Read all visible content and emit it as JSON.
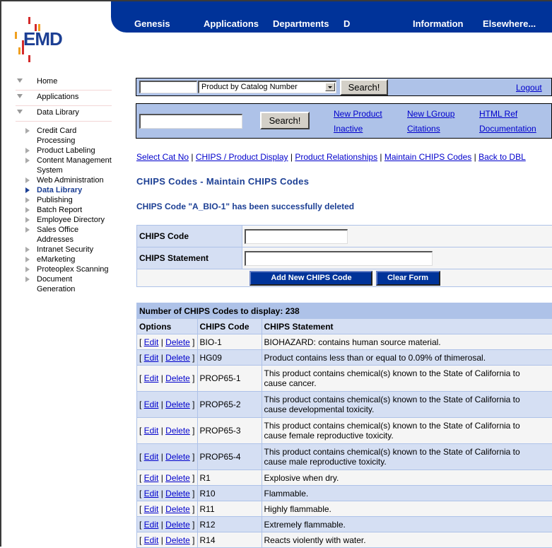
{
  "logo": {
    "text": "EMD",
    "colors": {
      "text": "#1c3f94",
      "red": "#d42a2a",
      "orange": "#f0a020"
    }
  },
  "topnav": {
    "items": [
      "Genesis",
      "Applications",
      "Departments",
      "D",
      "Information",
      "Elsewhere..."
    ],
    "background": "#003399"
  },
  "sidebar": {
    "top_items": [
      {
        "label": "Home",
        "icon": "triangle-down-icon"
      },
      {
        "label": "Applications",
        "icon": "triangle-down-icon"
      },
      {
        "label": "Data Library",
        "icon": "triangle-down-icon"
      }
    ],
    "sub_items": [
      {
        "label": "Credit Card Processing",
        "lines": [
          "Credit Card",
          "Processing"
        ],
        "active": false
      },
      {
        "label": "Product Labeling",
        "lines": [
          "Product Labeling"
        ],
        "active": false
      },
      {
        "label": "Content Management System",
        "lines": [
          "Content Management",
          "System"
        ],
        "active": false
      },
      {
        "label": "Web Administration",
        "lines": [
          "Web Administration"
        ],
        "active": false
      },
      {
        "label": "Data Library",
        "lines": [
          "Data Library"
        ],
        "active": true
      },
      {
        "label": "Publishing",
        "lines": [
          "Publishing"
        ],
        "active": false
      },
      {
        "label": "Batch Report",
        "lines": [
          "Batch Report"
        ],
        "active": false
      },
      {
        "label": "Employee Directory",
        "lines": [
          "Employee Directory"
        ],
        "active": false
      },
      {
        "label": "Sales Office Addresses",
        "lines": [
          "Sales Office",
          "Addresses"
        ],
        "active": false
      },
      {
        "label": "Intranet Security",
        "lines": [
          "Intranet Security"
        ],
        "active": false
      },
      {
        "label": "eMarketing",
        "lines": [
          "eMarketing"
        ],
        "active": false
      },
      {
        "label": "Proteoplex Scanning",
        "lines": [
          "Proteoplex Scanning"
        ],
        "active": false
      },
      {
        "label": "Document Generation",
        "lines": [
          "Document Generation"
        ],
        "active": false
      }
    ]
  },
  "search_bar": {
    "input_value": "",
    "select_value": "Product by Catalog Number",
    "search_label": "Search!",
    "logout_label": "Logout"
  },
  "quick_bar": {
    "input_value": "",
    "search_label": "Search!",
    "links": {
      "new_product": "New Product",
      "inactive": "Inactive",
      "new_lgroup": "New LGroup",
      "citations": "Citations",
      "html_ref": "HTML Ref",
      "documentation": "Documentation"
    }
  },
  "breadcrumbs": [
    "Select Cat No",
    "CHIPS / Product Display",
    "Product Relationships",
    "Maintain CHIPS Codes",
    "Back to DBL"
  ],
  "page_title": "CHIPS Codes - Maintain CHIPS Codes",
  "status_message": "CHIPS Code \"A_BIO-1\" has been successfully deleted",
  "form": {
    "code_label": "CHIPS Code",
    "code_value": "",
    "statement_label": "CHIPS Statement",
    "statement_value": "",
    "add_label": "Add New CHIPS Code",
    "clear_label": "Clear Form"
  },
  "list": {
    "count_text": "Number of CHIPS Codes to display: 238",
    "headers": [
      "Options",
      "CHIPS Code",
      "CHIPS Statement"
    ],
    "edit_label": "Edit",
    "delete_label": "Delete",
    "rows": [
      {
        "code": "BIO-1",
        "statement": "BIOHAZARD: contains human source material."
      },
      {
        "code": "HG09",
        "statement": "Product contains less than or equal to 0.09% of thimerosal."
      },
      {
        "code": "PROP65-1",
        "statement": "This product contains chemical(s) known to the State of California to cause cancer."
      },
      {
        "code": "PROP65-2",
        "statement": "This product contains chemical(s) known to the State of California to cause developmental toxicity."
      },
      {
        "code": "PROP65-3",
        "statement": "This product contains chemical(s) known to the State of California to cause female reproductive toxicity."
      },
      {
        "code": "PROP65-4",
        "statement": "This product contains chemical(s) known to the State of California to cause male reproductive toxicity."
      },
      {
        "code": "R1",
        "statement": "Explosive when dry."
      },
      {
        "code": "R10",
        "statement": "Flammable."
      },
      {
        "code": "R11",
        "statement": "Highly flammable."
      },
      {
        "code": "R12",
        "statement": "Extremely flammable."
      },
      {
        "code": "R14",
        "statement": "Reacts violently with water."
      }
    ]
  }
}
